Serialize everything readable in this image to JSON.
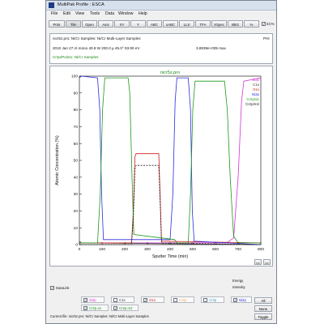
{
  "window": {
    "title": "MultiPak Profile : ESCA"
  },
  "menu": [
    "File",
    "Edit",
    "View",
    "Tools",
    "Data",
    "Window",
    "Help"
  ],
  "toolbar": {
    "buttons": [
      "Print",
      "Tile",
      "Open",
      "Axis",
      "XY",
      "Y",
      "ABC",
      "xABC",
      "LLS",
      "TFA",
      "XSpec",
      "Bkt3",
      "%"
    ],
    "toggle_label": "ΣC%"
  },
  "info": {
    "file_line": "nicr5z.pro: Ni/Cr Samples: Ni/Cr Multi-Layer Samples",
    "vendor": "PHI",
    "date_line": "2010 Jan 27  Al mono  40.8 W  200.0 µ  45.0°  93.90 eV",
    "max_value": "3.8939e+005 max",
    "region_line": "Cr2p/Point1: Ni/Cr Samples"
  },
  "colors": {
    "Si2p": "#d633d6",
    "C1s": "#333333",
    "O1s": "#d11a1a",
    "Cr2p": "#f4a860",
    "Ni2p": "#2b2be0",
    "Cr2p_a1": "#1a9a1a",
    "Cr2p_m2": "#202020",
    "green_text": "#1a8a1a",
    "navy_text": "#1a1a8a"
  },
  "chart_data": {
    "type": "line",
    "title": "nicr5z.pro",
    "xlabel": "Sputter Time (min)",
    "ylabel": "Atomic Concentration (%)",
    "xlim": [
      0,
      800
    ],
    "ylim": [
      0,
      100
    ],
    "xticks": [
      0,
      100,
      200,
      300,
      400,
      500,
      600,
      700,
      800
    ],
    "yticks": [
      0,
      10,
      20,
      30,
      40,
      50,
      60,
      70,
      80,
      90,
      100
    ],
    "legend_position": "top-right",
    "series": [
      {
        "name": "Si2p",
        "color": "#d633d6",
        "dash": "",
        "points": [
          [
            0,
            1
          ],
          [
            650,
            1
          ],
          [
            680,
            4
          ],
          [
            700,
            40
          ],
          [
            715,
            85
          ],
          [
            725,
            97
          ],
          [
            800,
            99
          ]
        ]
      },
      {
        "name": "C1s",
        "color": "#333333",
        "dash": "",
        "points": [
          [
            0,
            2
          ],
          [
            10,
            1
          ],
          [
            800,
            0
          ]
        ]
      },
      {
        "name": "O1s",
        "color": "#d11a1a",
        "dash": "",
        "points": [
          [
            0,
            1
          ],
          [
            230,
            1
          ],
          [
            238,
            20
          ],
          [
            245,
            52
          ],
          [
            250,
            54
          ],
          [
            350,
            54
          ],
          [
            356,
            30
          ],
          [
            362,
            2
          ],
          [
            800,
            1
          ]
        ]
      },
      {
        "name": "Ni2p",
        "color": "#2b2be0",
        "dash": "",
        "points": [
          [
            0,
            99
          ],
          [
            8,
            100
          ],
          [
            80,
            99
          ],
          [
            90,
            80
          ],
          [
            98,
            30
          ],
          [
            106,
            3
          ],
          [
            400,
            3
          ],
          [
            412,
            30
          ],
          [
            422,
            85
          ],
          [
            430,
            99
          ],
          [
            480,
            99
          ],
          [
            490,
            80
          ],
          [
            498,
            20
          ],
          [
            506,
            2
          ],
          [
            800,
            0
          ]
        ]
      },
      {
        "name": "Cr2p/a1",
        "color": "#1a9a1a",
        "dash": "",
        "points": [
          [
            0,
            1
          ],
          [
            80,
            1
          ],
          [
            92,
            30
          ],
          [
            102,
            80
          ],
          [
            112,
            99
          ],
          [
            215,
            99
          ],
          [
            222,
            90
          ],
          [
            232,
            40
          ],
          [
            240,
            6
          ],
          [
            420,
            3
          ],
          [
            430,
            1
          ],
          [
            480,
            1
          ],
          [
            490,
            30
          ],
          [
            500,
            80
          ],
          [
            510,
            97
          ],
          [
            640,
            97
          ],
          [
            652,
            80
          ],
          [
            665,
            40
          ],
          [
            680,
            5
          ],
          [
            700,
            1
          ],
          [
            800,
            1
          ]
        ]
      },
      {
        "name": "Cr2p/m2",
        "color": "#202020",
        "dash": "2,1.5",
        "points": [
          [
            0,
            0
          ],
          [
            230,
            0
          ],
          [
            238,
            15
          ],
          [
            245,
            45
          ],
          [
            250,
            47
          ],
          [
            350,
            47
          ],
          [
            356,
            25
          ],
          [
            362,
            1
          ],
          [
            800,
            0
          ]
        ]
      }
    ]
  },
  "nav": {
    "prev": "<<",
    "next": ">>"
  },
  "readouts": {
    "energy_label": "Energy",
    "intensity_label": "Intensity"
  },
  "datalink": {
    "label": "DataLink",
    "checked": true
  },
  "spectra": [
    {
      "label": "Si2p",
      "checked": true
    },
    {
      "label": "C1s",
      "checked": false
    },
    {
      "label": "O1s",
      "checked": true
    },
    {
      "label": "Cr2p",
      "checked": false
    },
    {
      "label": "Cr3p",
      "checked": false
    },
    {
      "label": "Ni2p",
      "checked": true
    },
    {
      "label": "Cr2p.a1",
      "checked": true
    },
    {
      "label": "Cr2p.m2",
      "checked": true
    }
  ],
  "side_buttons": [
    "All",
    "None",
    "Toggle"
  ],
  "status": {
    "text": "Current file: nicr5z.pro: Ni/Cr Samples: Ni/Cr Multi-Layer Samples"
  }
}
